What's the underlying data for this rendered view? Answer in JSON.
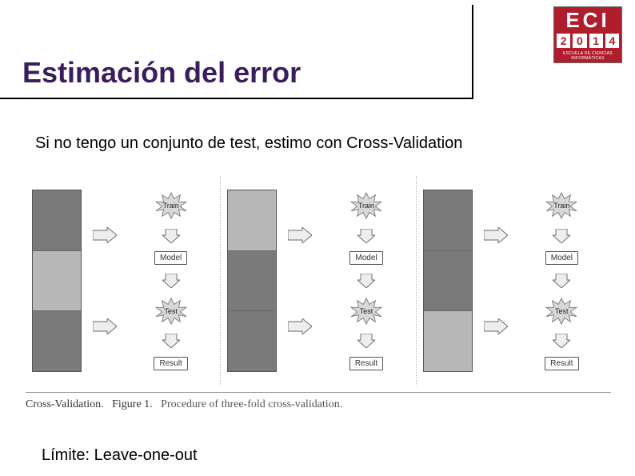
{
  "logo": {
    "acronym": "ECI",
    "year_digits": [
      "2",
      "0",
      "1",
      "4"
    ],
    "caption": "ESCUELA DE CIENCIAS INFORMÁTICAS"
  },
  "title": "Estimación del error",
  "subtitle": "Si no tengo un conjunto de test, estimo con Cross-Validation",
  "footer_note": "Límite: Leave-one-out",
  "caption": {
    "lead": "Cross-Validation.",
    "fig": "Figure 1.",
    "text": "Procedure of three-fold cross-validation."
  },
  "diagram": {
    "labels": {
      "train": "Train",
      "test": "Test",
      "model": "Model",
      "result": "Result"
    },
    "folds": [
      {
        "light_index": 1
      },
      {
        "light_index": 0
      },
      {
        "light_index": 2
      }
    ]
  }
}
